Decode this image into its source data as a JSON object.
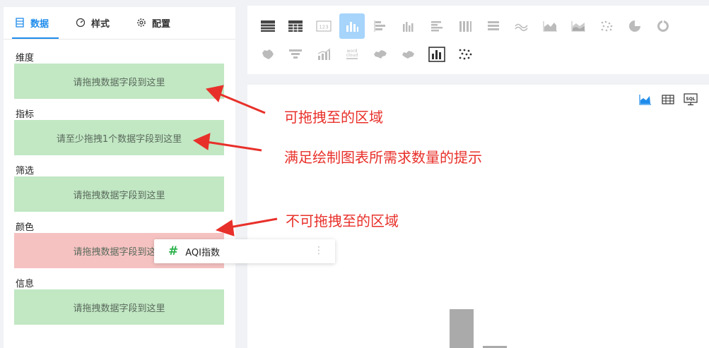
{
  "tabs": [
    {
      "label": "数据",
      "icon": "table-icon",
      "active": true
    },
    {
      "label": "样式",
      "icon": "gauge-icon",
      "active": false
    },
    {
      "label": "配置",
      "icon": "gear-icon",
      "active": false
    }
  ],
  "sections": [
    {
      "label": "维度",
      "placeholder": "请拖拽数据字段到这里",
      "state": "allowed"
    },
    {
      "label": "指标",
      "placeholder": "请至少拖拽1个数据字段到这里",
      "state": "allowed"
    },
    {
      "label": "筛选",
      "placeholder": "请拖拽数据字段到这里",
      "state": "allowed"
    },
    {
      "label": "颜色",
      "placeholder": "请拖拽数据字段到这里",
      "state": "forbidden"
    },
    {
      "label": "信息",
      "placeholder": "请拖拽数据字段到这里",
      "state": "allowed"
    }
  ],
  "drag_field": {
    "symbol": "#",
    "name": "AQI指数",
    "more": "⋮"
  },
  "annotations": {
    "droppable": "可拖拽至的区域",
    "requirement_hint": "满足绘制图表所需求数量的提示",
    "not_droppable": "不可拖拽至的区域"
  },
  "chart_types": [
    "table-icon",
    "cross-table-icon",
    "kpi-card-icon",
    "column-chart-icon",
    "bar-chart-icon",
    "grouped-column-icon",
    "grouped-bar-icon",
    "stacked-column-icon",
    "stacked-bar-icon",
    "wave-line-icon",
    "area-chart-icon",
    "stacked-area-icon",
    "scatter-dots-icon",
    "pie-chart-icon",
    "donut-chart-icon",
    "map-icon",
    "funnel-icon",
    "combo-chart-icon",
    "word-cloud-icon",
    "china-map-icon",
    "region-map-icon",
    "framed-bar-icon",
    "dot-grid-icon"
  ],
  "selected_chart_type": "column-chart-icon",
  "view_toggles": [
    "chart-view-icon",
    "table-view-icon",
    "sql-view-icon"
  ],
  "colors": {
    "accent": "#1f8ceb",
    "drop_allowed": "#c1e7c3",
    "drop_forbidden": "#f5c2c1",
    "annotation_red": "#e8302a",
    "number_field_green": "#2bb24c"
  }
}
